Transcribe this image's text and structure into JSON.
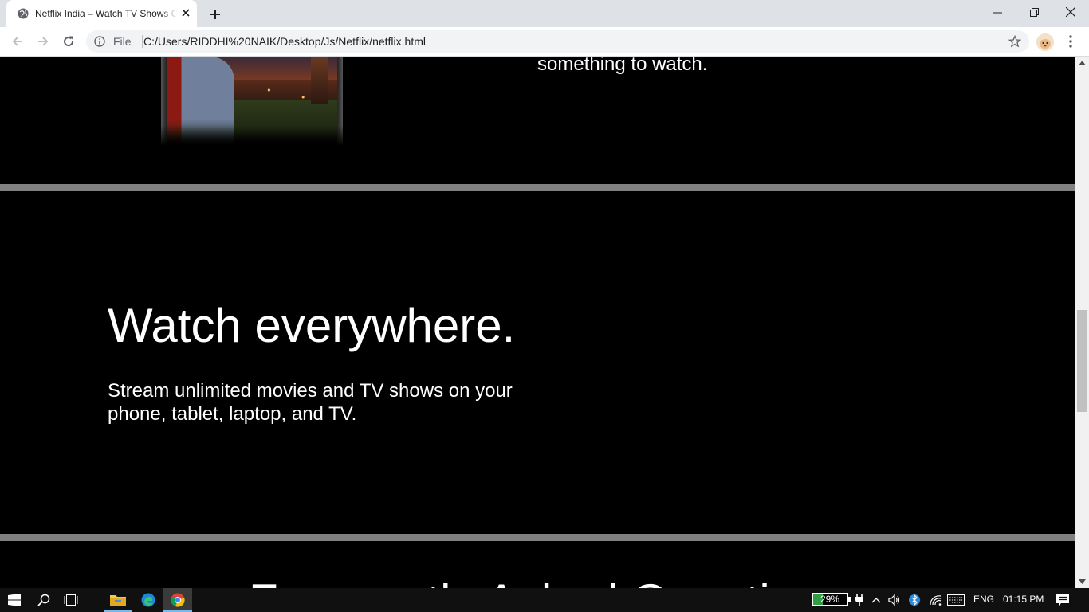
{
  "browser": {
    "tab_title": "Netflix India – Watch TV Shows Online, Watch Movies Online",
    "scheme_label": "File",
    "url": "C:/Users/RIDDHI%20NAIK/Desktop/Js/Netflix/netflix.html"
  },
  "page": {
    "previous_section_tail": "something to watch.",
    "section": {
      "heading": "Watch everywhere.",
      "body": "Stream unlimited movies and TV shows on your phone, tablet, laptop, and TV."
    },
    "next_section_heading": "Frequently Asked Questions"
  },
  "scroll": {
    "position_fraction": 0.5
  },
  "taskbar": {
    "battery_percent_label": "29%",
    "battery_level": 0.29,
    "language": "ENG",
    "time": "01:15 PM"
  },
  "colors": {
    "page_background": "#000000",
    "divider": "#808080",
    "text": "#ffffff",
    "taskbar": "#101010",
    "battery_fill": "#2f9e44"
  },
  "icons": {
    "tab_favicon": "globe-icon",
    "tab_close": "close-icon",
    "new_tab": "plus-icon",
    "back": "back-arrow-icon",
    "forward": "forward-arrow-icon",
    "reload": "reload-icon",
    "site_info": "info-icon",
    "bookmark": "star-icon",
    "menu": "kebab-menu-icon"
  }
}
